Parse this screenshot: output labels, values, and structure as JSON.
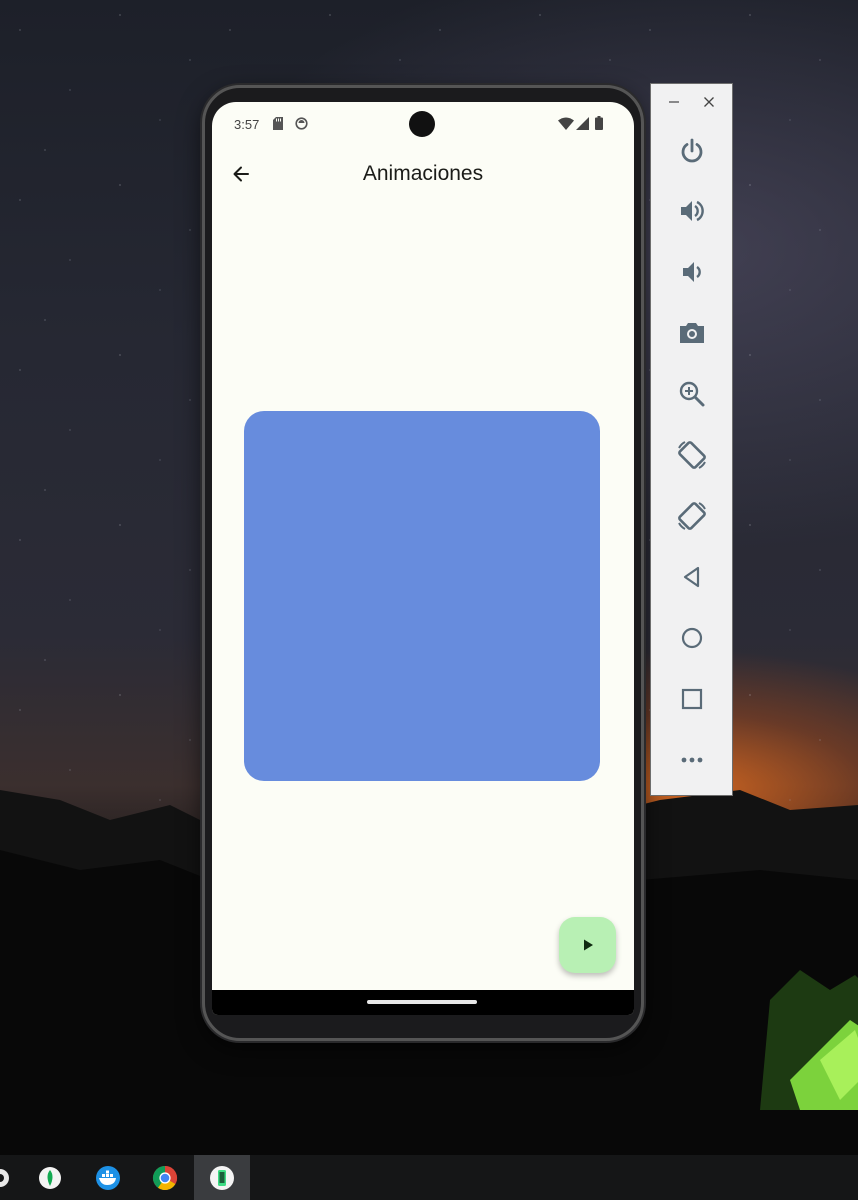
{
  "phone": {
    "status_bar": {
      "time": "3:57",
      "icons": [
        "sd-card-icon",
        "sync-icon",
        "wifi-icon",
        "cellular-signal-icon",
        "battery-icon"
      ]
    },
    "app_bar": {
      "title": "Animaciones",
      "back_icon": "arrow-back-icon"
    },
    "animated_box": {
      "color": "#678cdd"
    },
    "fab": {
      "icon": "play-icon",
      "color": "#b8f0b4"
    },
    "theme": {
      "background": "#fcfdf6"
    }
  },
  "emulator_toolbar": {
    "window_controls": [
      "minimize-icon",
      "close-icon"
    ],
    "buttons": [
      "power-icon",
      "volume-up-icon",
      "volume-down-icon",
      "screenshot-camera-icon",
      "zoom-icon",
      "rotate-left-icon",
      "rotate-right-icon",
      "back-triangle-icon",
      "home-circle-icon",
      "overview-square-icon",
      "more-dots-icon"
    ],
    "icon_color": "#5a6b78"
  },
  "taskbar": {
    "items": [
      "settings-gear-icon",
      "mongodb-icon",
      "docker-icon",
      "chrome-icon",
      "android-emulator-icon"
    ],
    "active_item": "android-emulator-icon"
  }
}
